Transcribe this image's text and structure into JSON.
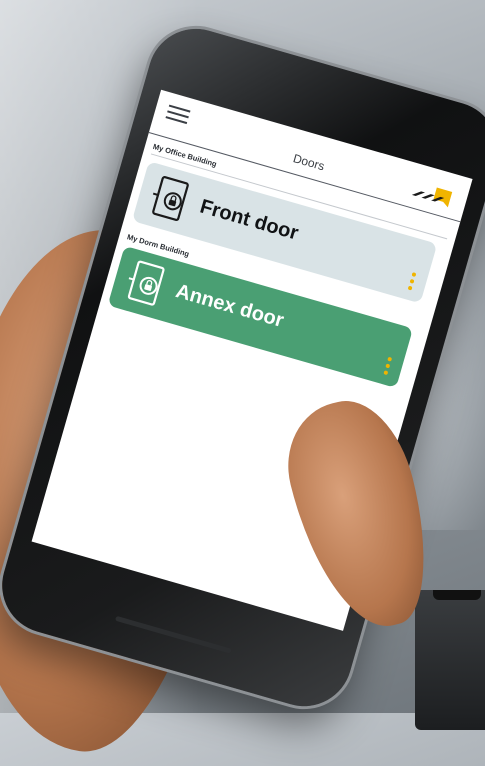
{
  "app": {
    "title": "Doors",
    "accent_color": "#f0b400",
    "brand_logo_icon": "brand-logo-icon"
  },
  "buildings": [
    {
      "name": "My Office Building",
      "door": {
        "name": "Front door",
        "icon": "door-lock-icon",
        "status_color": "#d9e3e6",
        "menu_icon": "kebab-menu-icon"
      }
    },
    {
      "name": "My Dorm Building",
      "door": {
        "name": "Annex door",
        "icon": "door-lock-icon",
        "status_color": "#4a9f73",
        "menu_icon": "kebab-menu-icon"
      }
    }
  ]
}
